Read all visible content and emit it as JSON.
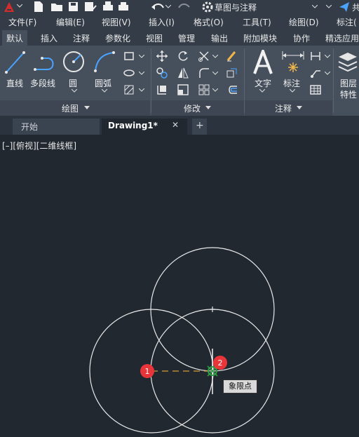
{
  "quick_access": {
    "workspace": "草图与注释",
    "share_label": "共"
  },
  "menu": [
    "文件(F)",
    "编辑(E)",
    "视图(V)",
    "插入(I)",
    "格式(O)",
    "工具(T)",
    "绘图(D)",
    "标注("
  ],
  "ribbon_tabs": [
    "默认",
    "插入",
    "注释",
    "参数化",
    "视图",
    "管理",
    "输出",
    "附加模块",
    "协作",
    "精选应用"
  ],
  "draw_panel": {
    "title": "绘图",
    "tools": [
      "直线",
      "多段线",
      "圆",
      "圆弧"
    ]
  },
  "modify_panel": {
    "title": "修改"
  },
  "annotation_panel": {
    "title": "注释",
    "tools": [
      "文字",
      "标注"
    ]
  },
  "layer_panel": {
    "label_line1": "图层",
    "label_line2": "特性"
  },
  "file_tabs": [
    {
      "label": "开始"
    },
    {
      "label": "Drawing1*",
      "close": "✕"
    }
  ],
  "add_tab_label": "+",
  "viewport": {
    "label": "[–][俯视][二维线框]"
  },
  "markers": {
    "m1": "1",
    "m2": "2"
  },
  "tooltip": "象限点",
  "colors": {
    "accent": "#e8353a",
    "snap": "#2ea043",
    "dash": "#d79b32"
  }
}
